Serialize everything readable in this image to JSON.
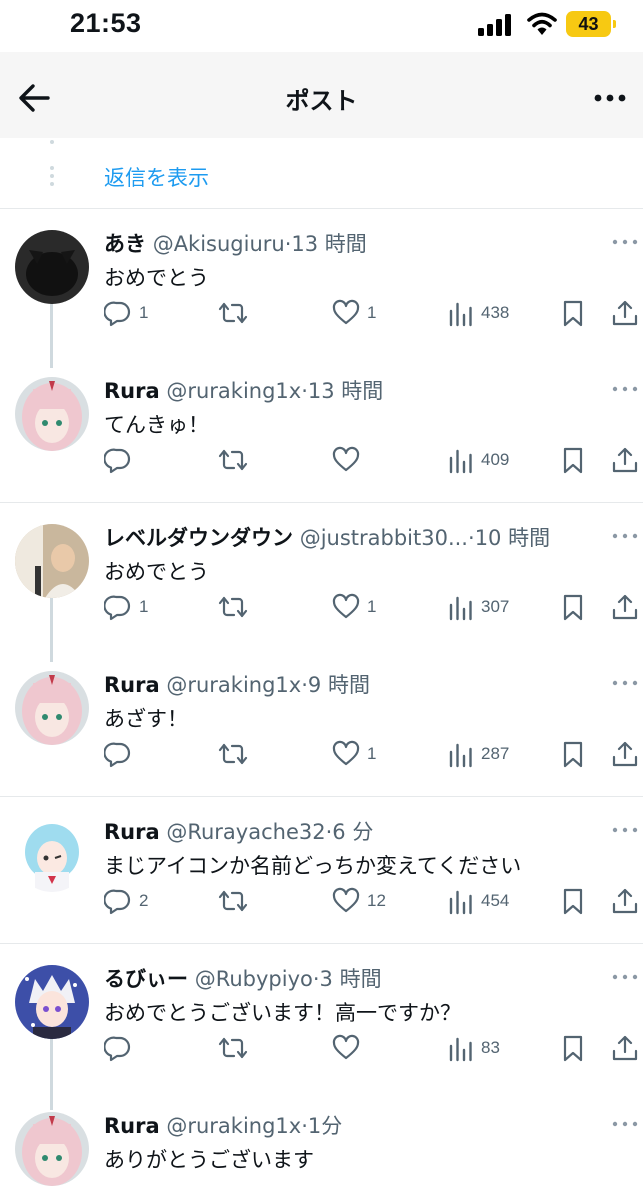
{
  "status_bar": {
    "time": "21:53",
    "battery": "43"
  },
  "header": {
    "title": "ポスト"
  },
  "show_replies": {
    "label": "返信を表示"
  },
  "tweets": [
    {
      "name": "あき",
      "handle": "@Akisugiuru",
      "sep": "·",
      "time": "13 時間",
      "text": "おめでとう",
      "replies": "1",
      "retweets": "",
      "likes": "1",
      "views": "438",
      "avatar_color": "#1d1d1d"
    },
    {
      "name": "Rura",
      "handle": "@ruraking1x",
      "sep": "·",
      "time": "13 時間",
      "text": "てんきゅ！",
      "replies": "",
      "retweets": "",
      "likes": "",
      "views": "409",
      "avatar_color": "#e7c9d0"
    },
    {
      "name": "レベルダウンダウン",
      "handle": "@justrabbit30...",
      "sep": "·",
      "time": "10 時間",
      "text": "おめでとう",
      "replies": "1",
      "retweets": "",
      "likes": "1",
      "views": "307",
      "avatar_color": "#cdb89f"
    },
    {
      "name": "Rura",
      "handle": "@ruraking1x",
      "sep": "·",
      "time": "9 時間",
      "text": "あざす！",
      "replies": "",
      "retweets": "",
      "likes": "1",
      "views": "287",
      "avatar_color": "#e7c9d0"
    },
    {
      "name": "Rura",
      "handle": "@Rurayache32",
      "sep": "·",
      "time": "6 分",
      "text": "まじアイコンか名前どっちか変えてください",
      "replies": "2",
      "retweets": "",
      "likes": "12",
      "views": "454",
      "avatar_color": "#a8dff0"
    },
    {
      "name": "るびぃー",
      "handle": "@Rubypiyo",
      "sep": "·",
      "time": "3 時間",
      "text": "おめでとうございます！高一ですか？",
      "replies": "",
      "retweets": "",
      "likes": "",
      "views": "83",
      "avatar_color": "#5a6fc4"
    },
    {
      "name": "Rura",
      "handle": "@ruraking1x",
      "sep": "·",
      "time": "1分",
      "text": "ありがとうございます",
      "replies": "",
      "retweets": "",
      "likes": "",
      "views": "",
      "avatar_color": "#e7c9d0"
    }
  ]
}
